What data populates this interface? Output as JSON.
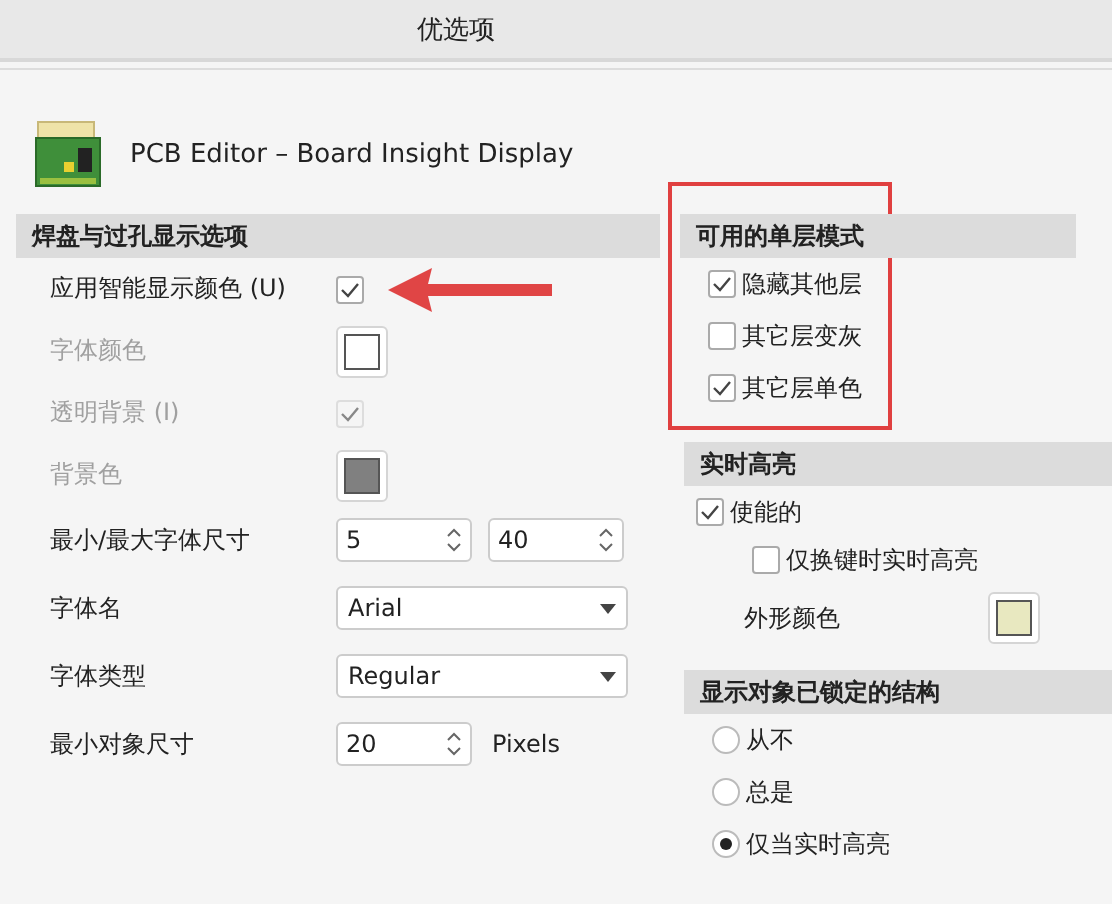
{
  "window": {
    "title": "优选项"
  },
  "header": {
    "title": "PCB Editor – Board Insight Display"
  },
  "left_section": {
    "title": "焊盘与过孔显示选项",
    "rows": [
      {
        "kind": "checkbox",
        "label": "应用智能显示颜色 (U)",
        "checked": true,
        "disabled": false,
        "pointed": true
      },
      {
        "kind": "color",
        "label": "字体颜色",
        "color": "#ffffff",
        "disabled": true
      },
      {
        "kind": "checkbox",
        "label": "透明背景 (I)",
        "checked": true,
        "disabled": true,
        "pointed": false
      },
      {
        "kind": "color",
        "label": "背景色",
        "color": "#808080",
        "disabled": true
      },
      {
        "kind": "spin2",
        "label": "最小/最大字体尺寸",
        "values": [
          "5",
          "40"
        ],
        "disabled": false
      },
      {
        "kind": "select",
        "label": "字体名",
        "value": "Arial",
        "disabled": false
      },
      {
        "kind": "select",
        "label": "字体类型",
        "value": "Regular",
        "disabled": false
      },
      {
        "kind": "spin",
        "label": "最小对象尺寸",
        "values": [
          "20"
        ],
        "unit": "Pixels",
        "disabled": false
      }
    ]
  },
  "single_layer": {
    "title": "可用的单层模式",
    "highlighted": true,
    "options": [
      {
        "label": "隐藏其他层",
        "checked": true
      },
      {
        "label": "其它层变灰",
        "checked": false
      },
      {
        "label": "其它层单色",
        "checked": true
      }
    ]
  },
  "live_highlight": {
    "title": "实时高亮",
    "enabled": {
      "label": "使能的",
      "checked": true
    },
    "only_on_key": {
      "label": "仅换键时实时高亮",
      "checked": false
    },
    "outline_color": {
      "label": "外形颜色",
      "color": "#e8e8c0"
    }
  },
  "locked_structures": {
    "title": "显示对象已锁定的结构",
    "options": [
      {
        "label": "从不",
        "selected": false
      },
      {
        "label": "总是",
        "selected": false
      },
      {
        "label": "仅当实时高亮",
        "selected": true
      }
    ]
  }
}
